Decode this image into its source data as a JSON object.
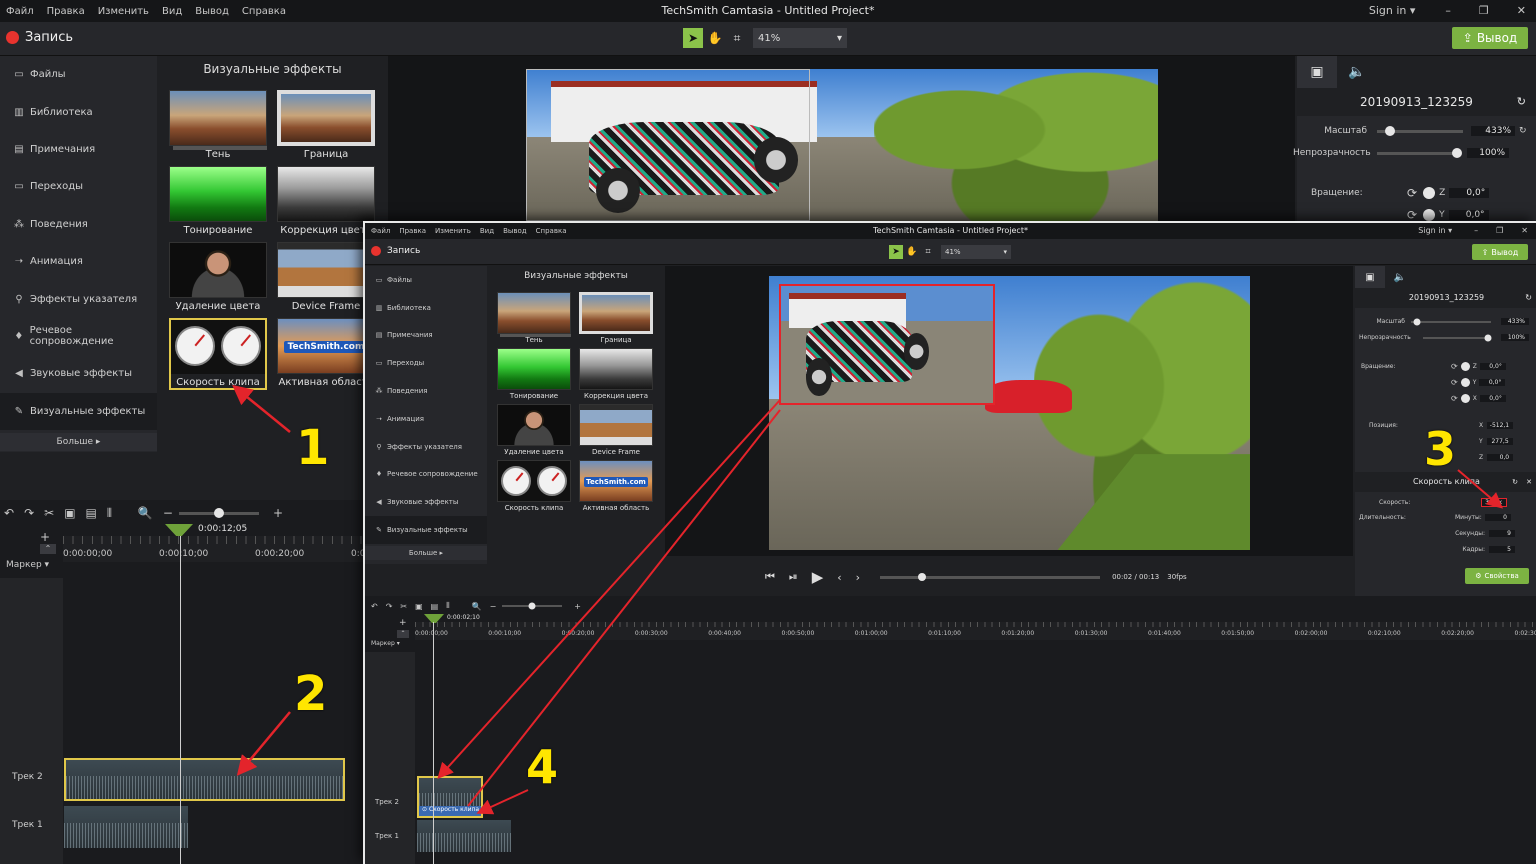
{
  "app": {
    "title": "TechSmith Camtasia - Untitled Project*",
    "menu": [
      "Файл",
      "Правка",
      "Изменить",
      "Вид",
      "Вывод",
      "Справка"
    ],
    "sign_in": "Sign in ▾",
    "win_controls": [
      "–",
      "❐",
      "✕"
    ],
    "record_label": "Запись",
    "zoom": "41%",
    "export_label": "Вывод"
  },
  "sidebar": {
    "items": [
      {
        "icon": "▭",
        "label": "Файлы"
      },
      {
        "icon": "▥",
        "label": "Библиотека"
      },
      {
        "icon": "▤",
        "label": "Примечания"
      },
      {
        "icon": "▭",
        "label": "Переходы"
      },
      {
        "icon": "⁂",
        "label": "Поведения"
      },
      {
        "icon": "➝",
        "label": "Анимация"
      },
      {
        "icon": "⚲",
        "label": "Эффекты указателя"
      },
      {
        "icon": "♦",
        "label": "Речевое сопровождение"
      },
      {
        "icon": "◀",
        "label": "Звуковые эффекты"
      },
      {
        "icon": "✎",
        "label": "Визуальные эффекты"
      }
    ],
    "more": "Больше ▸"
  },
  "library": {
    "title": "Визуальные эффекты",
    "tiles": [
      {
        "label": "Тень"
      },
      {
        "label": "Граница"
      },
      {
        "label": "Тонирование"
      },
      {
        "label": "Коррекция цвета"
      },
      {
        "label": "Удаление цвета"
      },
      {
        "label": "Device Frame"
      },
      {
        "label": "Скорость клипа"
      },
      {
        "label": "Активная область"
      }
    ],
    "techsmith_badge": "TechSmith.com"
  },
  "properties": {
    "clip_name": "20190913_123259",
    "scale_label": "Масштаб",
    "scale_value": "433%",
    "opacity_label": "Непрозрачность",
    "opacity_value": "100%",
    "rotation_label": "Вращение:",
    "rot_z_label": "Z",
    "rot_z": "0,0°",
    "rot_y_label": "Y",
    "rot_y": "0,0°",
    "rot_x_label": "X",
    "rot_x": "0,0°",
    "position_label": "Позиция:",
    "pos_x_label": "X",
    "pos_x": "-512,1",
    "pos_y_label": "Y",
    "pos_y": "277,5",
    "pos_z_label": "Z",
    "pos_z": "0,0",
    "speed_section": "Скорость клипа",
    "speed_label": "Скорость:",
    "speed_value": "3,20x",
    "duration_label": "Длительность:",
    "minutes_label": "Минуты:",
    "minutes": "0",
    "seconds_label": "Секунды:",
    "seconds": "9",
    "frames_label": "Кадры:",
    "frames": "5",
    "properties_btn": "Свойства",
    "scale_level": 0.15,
    "opacity_level": 1.0,
    "scale_level_small": 0.08,
    "opacity_level_small": 0.95
  },
  "player": {
    "time": "00:02 / 00:13",
    "fps": "30fps",
    "progress": 0.19
  },
  "timeline": {
    "marker": "Маркер ▾",
    "playhead_time_big": "0:00:12;05",
    "playhead_time_small": "0:00:02;10",
    "ruler_big": [
      "0:00:00;00",
      "0:00:10;00",
      "0:00:20;00",
      "0:0"
    ],
    "ruler_small": [
      "0:00:00;00",
      "0:00:10;00",
      "0:00:20;00",
      "0:00:30;00",
      "0:00:40;00",
      "0:00:50;00",
      "0:01:00;00",
      "0:01:10;00",
      "0:01:20;00",
      "0:01:30;00",
      "0:01:40;00",
      "0:01:50;00",
      "0:02:00;00",
      "0:02:10;00",
      "0:02:20;00",
      "0:02:30"
    ],
    "track2": "Трек 2",
    "track1": "Трек 1",
    "speed_clip_label": "Скорость клипа"
  },
  "annotations": [
    "1",
    "2",
    "3",
    "4"
  ],
  "colors": {
    "accent_green": "#7cb342",
    "record_red": "#e8332e",
    "annotation_yellow": "#ffe600",
    "arrow_red": "#e4242b"
  }
}
